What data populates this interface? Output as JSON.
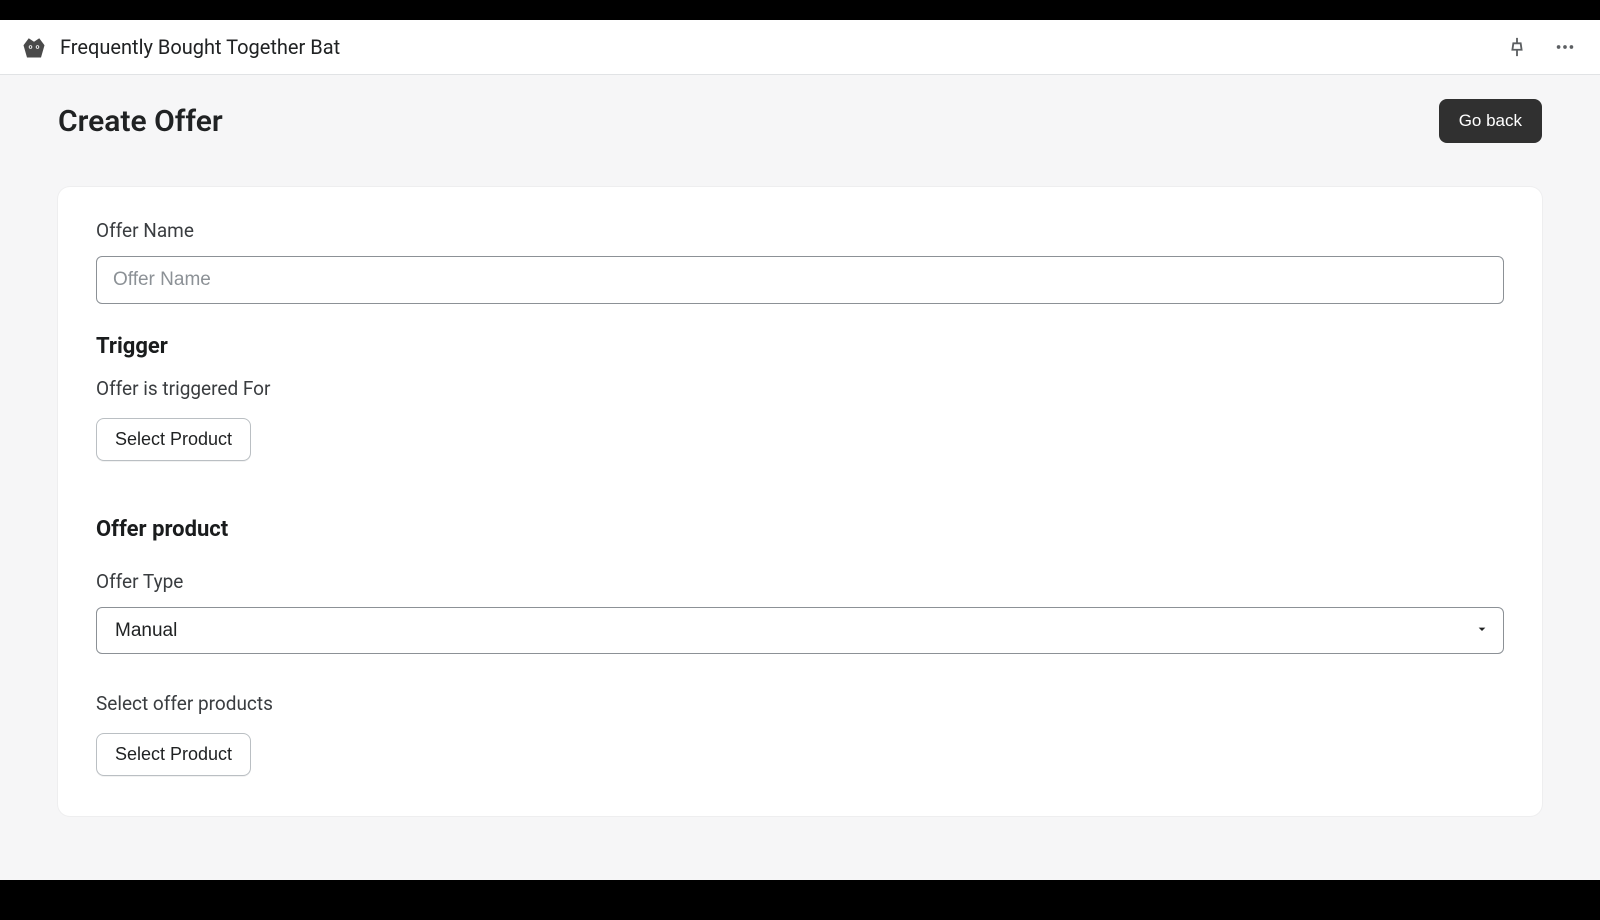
{
  "header": {
    "app_title": "Frequently Bought Together Bat",
    "pin_icon": "pin",
    "more_icon": "more"
  },
  "page": {
    "title": "Create Offer",
    "go_back": "Go back"
  },
  "form": {
    "offer_name_label": "Offer Name",
    "offer_name_placeholder": "Offer Name",
    "offer_name_value": "",
    "trigger_heading": "Trigger",
    "trigger_label": "Offer is triggered For",
    "select_product_btn": "Select Product",
    "offer_product_heading": "Offer product",
    "offer_type_label": "Offer Type",
    "offer_type_value": "Manual",
    "select_offer_products_label": "Select offer products",
    "select_offer_product_btn": "Select Product"
  }
}
